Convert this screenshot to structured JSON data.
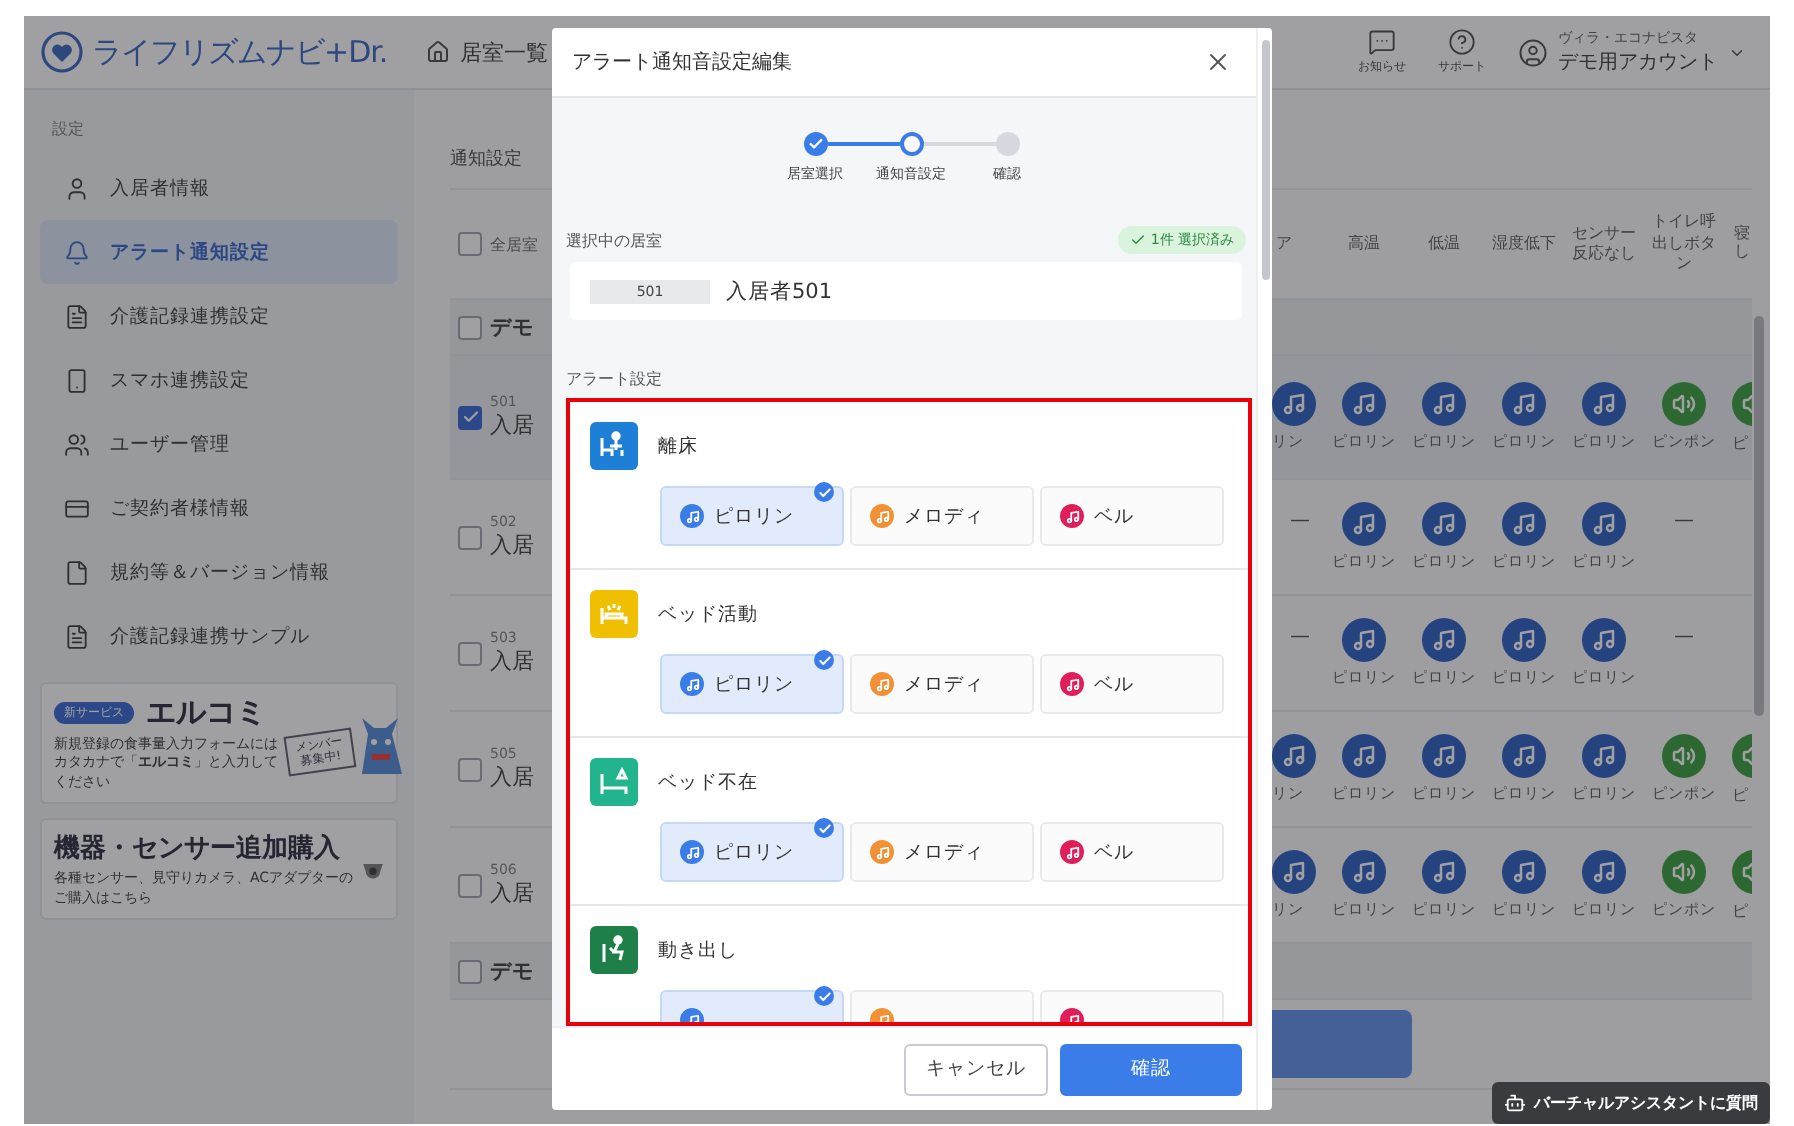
{
  "header": {
    "logo": "ライフリズムナビ+Dr.",
    "nav": "居室一覧",
    "actions": [
      {
        "label": "お知らせ",
        "kind": "notice"
      },
      {
        "label": "サポート",
        "kind": "help"
      }
    ],
    "account": {
      "facility": "ヴィラ・エコナビスタ",
      "name": "デモ用アカウント"
    }
  },
  "sidebar": {
    "section": "設定",
    "items": [
      {
        "label": "入居者情報",
        "kind": "resident",
        "selected": false
      },
      {
        "label": "アラート通知設定",
        "kind": "bell",
        "selected": true
      },
      {
        "label": "介護記録連携設定",
        "kind": "record",
        "selected": false
      },
      {
        "label": "スマホ連携設定",
        "kind": "phone",
        "selected": false
      },
      {
        "label": "ユーザー管理",
        "kind": "users",
        "selected": false
      },
      {
        "label": "ご契約者様情報",
        "kind": "contract",
        "selected": false
      },
      {
        "label": "規約等＆バージョン情報",
        "kind": "terms",
        "selected": false
      },
      {
        "label": "介護記録連携サンプル",
        "kind": "record",
        "selected": false
      }
    ],
    "promos": [
      {
        "kind": "new_service",
        "badge": "新サービス",
        "title": "エルコミ",
        "text": "新規登録の食事量入力フォームにはカタカナで「**エルコミ**」と入力してください",
        "sign": "メンバー募集中!"
      },
      {
        "kind": "purchase",
        "title": "機器・センサー追加購入",
        "text": "各種センサー、見守りカメラ、ACアダプターのご購入はこちら"
      }
    ]
  },
  "main": {
    "title": "通知設定",
    "table": {
      "select_all": {
        "label": "全居室",
        "checked": false
      },
      "columns": [
        "ア",
        "高温",
        "低温",
        "湿度低下",
        "センサー反応なし",
        "トイレ呼出しボタン",
        "寝し"
      ],
      "rows": [
        {
          "kind": "group",
          "label": "デモ",
          "checked": false
        },
        {
          "kind": "room",
          "room": "501",
          "name": "入居",
          "checked": true,
          "cells": [
            {
              "kind": "melody",
              "label": "リン"
            },
            {
              "kind": "melody",
              "label": "ピロリン"
            },
            {
              "kind": "melody",
              "label": "ピロリン"
            },
            {
              "kind": "melody",
              "label": "ピロリン"
            },
            {
              "kind": "melody",
              "label": "ピロリン"
            },
            {
              "kind": "chime",
              "label": "ピンポン"
            },
            {
              "kind": "chime",
              "label": "ピ"
            }
          ]
        },
        {
          "kind": "room",
          "room": "502",
          "name": "入居",
          "checked": false,
          "cells": [
            {
              "kind": "none",
              "label": "—"
            },
            {
              "kind": "melody",
              "label": "ピロリン"
            },
            {
              "kind": "melody",
              "label": "ピロリン"
            },
            {
              "kind": "melody",
              "label": "ピロリン"
            },
            {
              "kind": "melody",
              "label": "ピロリン"
            },
            {
              "kind": "none",
              "label": "—"
            }
          ]
        },
        {
          "kind": "room",
          "room": "503",
          "name": "入居",
          "checked": false,
          "cells": [
            {
              "kind": "none",
              "label": "—"
            },
            {
              "kind": "melody",
              "label": "ピロリン"
            },
            {
              "kind": "melody",
              "label": "ピロリン"
            },
            {
              "kind": "melody",
              "label": "ピロリン"
            },
            {
              "kind": "melody",
              "label": "ピロリン"
            },
            {
              "kind": "none",
              "label": "—"
            }
          ]
        },
        {
          "kind": "room",
          "room": "505",
          "name": "入居",
          "checked": false,
          "cells": [
            {
              "kind": "melody",
              "label": "リン"
            },
            {
              "kind": "melody",
              "label": "ピロリン"
            },
            {
              "kind": "melody",
              "label": "ピロリン"
            },
            {
              "kind": "melody",
              "label": "ピロリン"
            },
            {
              "kind": "melody",
              "label": "ピロリン"
            },
            {
              "kind": "chime",
              "label": "ピンポン"
            },
            {
              "kind": "chime",
              "label": "ピ"
            }
          ]
        },
        {
          "kind": "room",
          "room": "506",
          "name": "入居",
          "checked": false,
          "cells": [
            {
              "kind": "melody",
              "label": "リン"
            },
            {
              "kind": "melody",
              "label": "ピロリン"
            },
            {
              "kind": "melody",
              "label": "ピロリン"
            },
            {
              "kind": "melody",
              "label": "ピロリン"
            },
            {
              "kind": "melody",
              "label": "ピロリン"
            },
            {
              "kind": "chime",
              "label": "ピンポン"
            },
            {
              "kind": "chime",
              "label": "ピ"
            }
          ]
        },
        {
          "kind": "group",
          "label": "デモ",
          "checked": false
        }
      ]
    }
  },
  "modal": {
    "title": "アラート通知音設定編集",
    "steps": [
      {
        "label": "居室選択",
        "kind": "done"
      },
      {
        "label": "通知音設定",
        "kind": "current"
      },
      {
        "label": "確認",
        "kind": "pending"
      }
    ],
    "selected_label": "選択中の居室",
    "selected_count": "1件 選択済み",
    "room": {
      "number": "501",
      "name": "入居者501"
    },
    "alert_label": "アラート設定",
    "alerts": [
      {
        "title": "離床",
        "kind": "leave_bed",
        "color": "#1e7fd6",
        "options": [
          {
            "label": "ピロリン",
            "color": "#3b7de8",
            "selected": true
          },
          {
            "label": "メロディ",
            "color": "#f29035",
            "selected": false
          },
          {
            "label": "ベル",
            "color": "#e01e5a",
            "selected": false
          }
        ]
      },
      {
        "title": "ベッド活動",
        "kind": "bed_activity",
        "color": "#f0c000",
        "options": [
          {
            "label": "ピロリン",
            "color": "#3b7de8",
            "selected": true
          },
          {
            "label": "メロディ",
            "color": "#f29035",
            "selected": false
          },
          {
            "label": "ベル",
            "color": "#e01e5a",
            "selected": false
          }
        ]
      },
      {
        "title": "ベッド不在",
        "kind": "bed_absent",
        "color": "#22b48c",
        "options": [
          {
            "label": "ピロリン",
            "color": "#3b7de8",
            "selected": true
          },
          {
            "label": "メロディ",
            "color": "#f29035",
            "selected": false
          },
          {
            "label": "ベル",
            "color": "#e01e5a",
            "selected": false
          }
        ]
      },
      {
        "title": "動き出し",
        "kind": "moving",
        "color": "#1e8048",
        "options": [
          {
            "color": "#3b7de8",
            "selected": true
          },
          {
            "color": "#f29035",
            "selected": false
          },
          {
            "color": "#e01e5a",
            "selected": false
          }
        ]
      }
    ],
    "buttons": [
      {
        "label": "キャンセル",
        "kind": "secondary"
      },
      {
        "label": "確認",
        "kind": "primary"
      }
    ]
  },
  "assistant": {
    "label": "バーチャルアシスタントに質問"
  }
}
